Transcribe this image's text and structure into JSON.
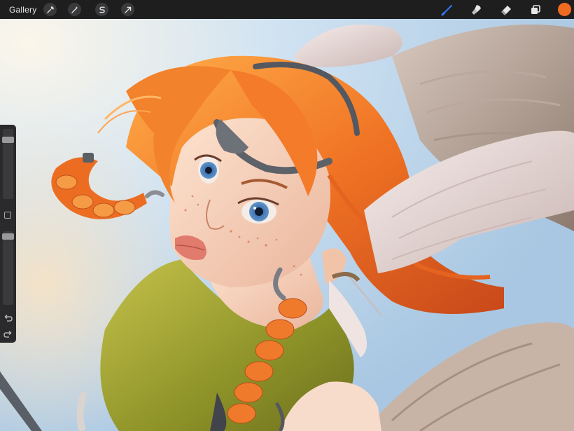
{
  "topbar": {
    "gallery_label": "Gallery",
    "left_tools": [
      {
        "name": "wrench-icon"
      },
      {
        "name": "magic-wand-icon"
      },
      {
        "name": "selection-icon"
      },
      {
        "name": "transform-arrow-icon"
      }
    ],
    "right_tools": [
      {
        "name": "brush-icon",
        "active": true,
        "active_color": "#2f7bf6"
      },
      {
        "name": "smudge-icon"
      },
      {
        "name": "eraser-icon"
      },
      {
        "name": "layers-icon"
      }
    ],
    "current_color": "#f06b22"
  },
  "sidebar": {
    "size_slider_level": 0.12,
    "opacity_slider_level": 0.03,
    "modify_button": "square",
    "undo_icon": "undo-icon",
    "redo_icon": "redo-icon"
  },
  "colors": {
    "toolbar_bg": "#1e1e1f",
    "sidebar_bg": "#2a2a2c",
    "hair": "#f07a2a",
    "sky": "#bcd8ef",
    "skin": "#f6d4bf",
    "scarf": "#8f9a2a",
    "wing": "#ece0df"
  }
}
